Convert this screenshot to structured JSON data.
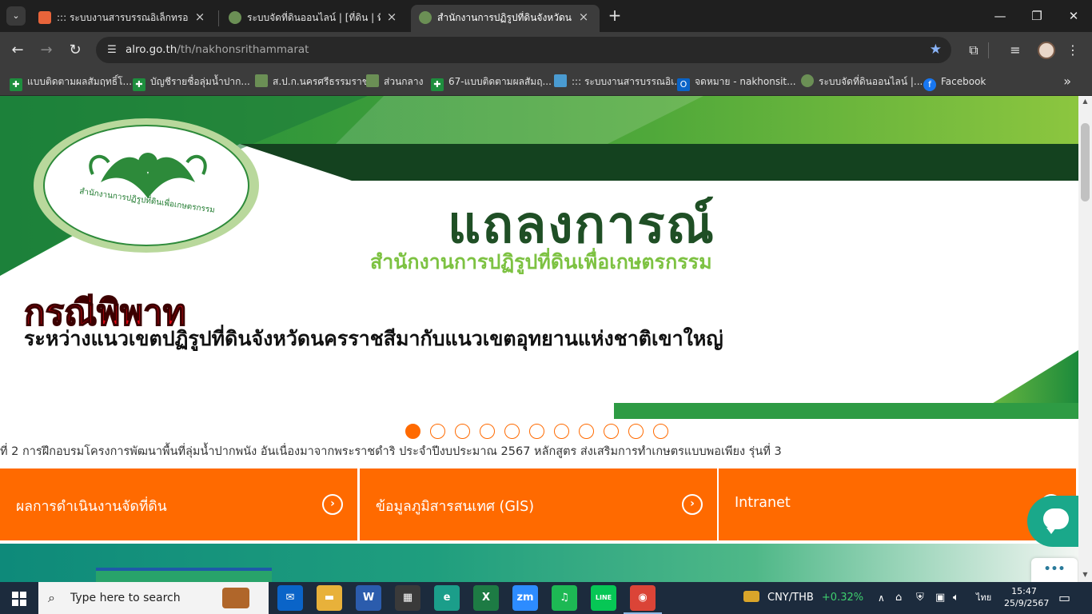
{
  "browser": {
    "tabs": [
      {
        "title": "::: ระบบงานสารบรรณอิเล็กทรอนิกส์ :::",
        "favicon_color": "#e8643a",
        "active": false
      },
      {
        "title": "ระบบจัดที่ดินออนไลน์ | [ที่ดิน | ที่ดินรัฐ]",
        "favicon_color": "#6b8f55",
        "active": false
      },
      {
        "title": "สำนักงานการปฏิรูปที่ดินจังหวัดนครศรีธรรมราช",
        "favicon_color": "#6b8f55",
        "active": true
      }
    ],
    "new_tab_symbol": "+",
    "url_host": "alro.go.th",
    "url_path": "/th/nakhonsrithammarat",
    "bookmarks": [
      {
        "label": "แบบติดตามผลสัมฤทธิ์โ...",
        "icon": "sheets-icon",
        "color": "#1e8e3e"
      },
      {
        "label": "บัญชีรายชื่อลุ่มน้ำปาก...",
        "icon": "sheets-icon",
        "color": "#1e8e3e"
      },
      {
        "label": "ส.ป.ก.นครศรีธรรมราช",
        "icon": "alro-icon",
        "color": "#6b8f55"
      },
      {
        "label": "ส่วนกลาง",
        "icon": "alro-icon",
        "color": "#6b8f55"
      },
      {
        "label": "67-แบบติดตามผลสัมฤ...",
        "icon": "sheets-icon",
        "color": "#1e8e3e"
      },
      {
        "label": "::: ระบบงานสารบรรณอิเ...",
        "icon": "saraban-icon",
        "color": "#4a9bd1"
      },
      {
        "label": "จดหมาย - nakhonsit...",
        "icon": "outlook-icon",
        "color": "#0a64c8"
      },
      {
        "label": "ระบบจัดที่ดินออนไลน์ |...",
        "icon": "alro-icon",
        "color": "#6b8f55"
      },
      {
        "label": "Facebook",
        "icon": "facebook-icon",
        "color": "#1877f2"
      }
    ]
  },
  "page": {
    "banner": {
      "seal_text": "สำนักงานการปฏิรูปที่ดินเพื่อเกษตรกรรม",
      "title": "แถลงการณ์",
      "subtitle": "สำนักงานการปฏิรูปที่ดินเพื่อเกษตรกรรม",
      "red_text": "กรณีพิพาท",
      "black_text": "ระหว่างแนวเขตปฏิรูปที่ดินจังหวัดนครราชสีมากับแนวเขตอุทยานแห่งชาติเขาใหญ่"
    },
    "slider": {
      "count": 11,
      "active_index": 0
    },
    "ticker": "ที่ 2     การฝึกอบรมโครงการพัฒนาพื้นที่ลุ่มน้ำปากพนัง อันเนื่องมาจากพระราชดำริ ประจำปีงบประมาณ 2567 หลักสูตร ส่งเสริมการทำเกษตรแบบพอเพียง รุ่นที่ 3",
    "quick_links": [
      {
        "label": "ผลการดำเนินงานจัดที่ดิน"
      },
      {
        "label": "ข้อมูลภูมิสารสนเทศ (GIS)"
      },
      {
        "label": "Intranet"
      }
    ],
    "more_symbol": "•••"
  },
  "taskbar": {
    "search_placeholder": "Type here to search",
    "apps": [
      {
        "name": "mail",
        "color": "#0a64c8",
        "glyph": "✉"
      },
      {
        "name": "file-explorer",
        "color": "#e8b13a",
        "glyph": "▬"
      },
      {
        "name": "word",
        "color": "#2b5cad",
        "glyph": "W"
      },
      {
        "name": "store",
        "color": "#3a3a3a",
        "glyph": "▦"
      },
      {
        "name": "edge",
        "color": "#1b9e8a",
        "glyph": "e"
      },
      {
        "name": "excel",
        "color": "#1d7b44",
        "glyph": "X"
      },
      {
        "name": "zoom",
        "color": "#2d8cff",
        "glyph": "zm"
      },
      {
        "name": "spotify",
        "color": "#1db954",
        "glyph": "♫"
      },
      {
        "name": "line",
        "color": "#06c755",
        "glyph": "LINE"
      },
      {
        "name": "chrome",
        "color": "#db4437",
        "glyph": "◉"
      }
    ],
    "ticker_symbol": "CNY/THB",
    "ticker_change": "+0.32%",
    "language": "ไทย",
    "time": "15:47",
    "date": "25/9/2567"
  }
}
